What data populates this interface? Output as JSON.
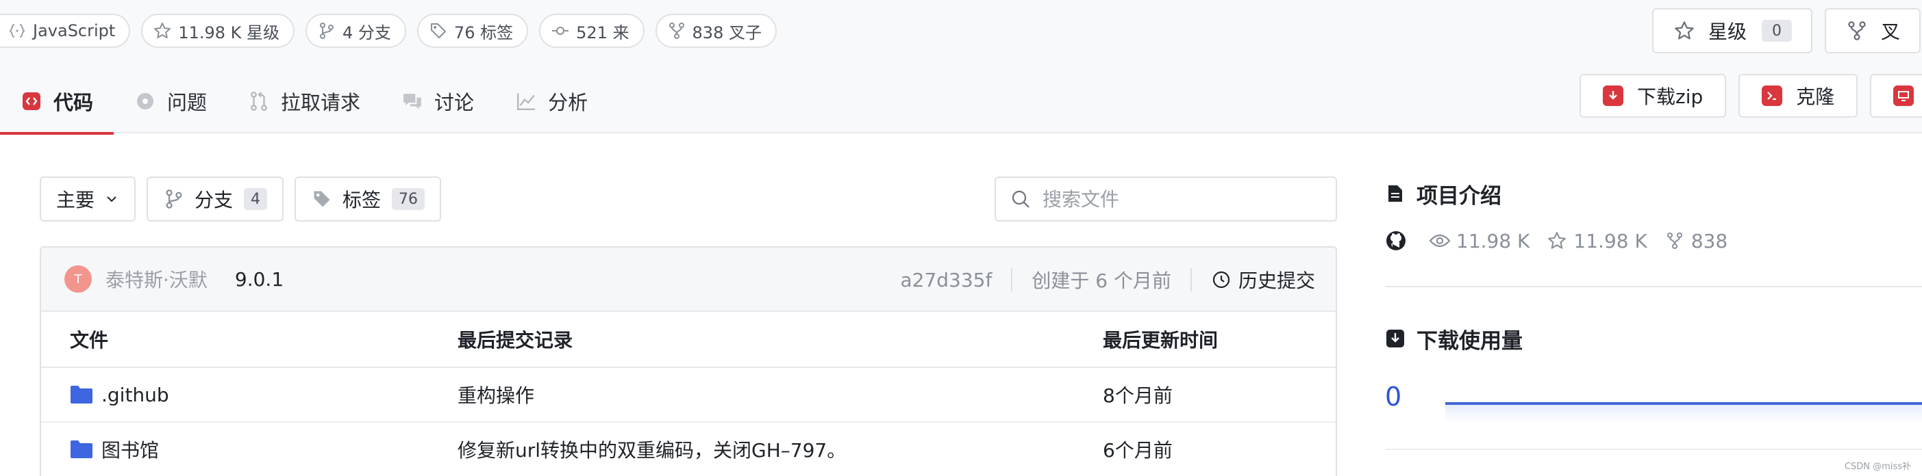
{
  "meta_chips": [
    {
      "icon": "code-braces-icon",
      "label": "JavaScript"
    },
    {
      "icon": "star-icon",
      "label": "11.98 K 星级"
    },
    {
      "icon": "branch-icon",
      "label": "4 分支"
    },
    {
      "icon": "tag-icon",
      "label": "76 标签"
    },
    {
      "icon": "commit-icon",
      "label": "521 来"
    },
    {
      "icon": "fork-icon",
      "label": "838 叉子"
    }
  ],
  "repo_actions": {
    "star_label": "星级",
    "star_count": "0",
    "fork_label": "叉"
  },
  "tabs": [
    {
      "icon": "code-icon",
      "label": "代码",
      "active": true
    },
    {
      "icon": "issue-icon",
      "label": "问题"
    },
    {
      "icon": "pull-request-icon",
      "label": "拉取请求"
    },
    {
      "icon": "discussion-icon",
      "label": "讨论"
    },
    {
      "icon": "analytics-icon",
      "label": "分析"
    }
  ],
  "download_actions": {
    "download_zip": "下载zip",
    "clone": "克隆"
  },
  "toolbar": {
    "branch_select": "主要",
    "branches_label": "分支",
    "branches_count": "4",
    "tags_label": "标签",
    "tags_count": "76",
    "search_placeholder": "搜索文件"
  },
  "commit": {
    "avatar_initial": "T",
    "author": "泰特斯·沃默",
    "message": "9.0.1",
    "sha": "a27d335f",
    "created": "创建于 6 个月前",
    "history": "历史提交"
  },
  "file_table": {
    "headers": [
      "文件",
      "最后提交记录",
      "最后更新时间"
    ],
    "rows": [
      {
        "name": ".github",
        "commit": "重构操作",
        "updated": "8个月前"
      },
      {
        "name": "图书馆",
        "commit": "修复新url转换中的双重编码，关闭GH–797。",
        "updated": "6个月前"
      }
    ]
  },
  "sidebar": {
    "intro_title": "项目介绍",
    "watch_count": "11.98 K",
    "star_count": "11.98 K",
    "fork_count": "838",
    "downloads_title": "下载使用量",
    "downloads_count": "0"
  },
  "watermark": "CSDN @miss补",
  "colors": {
    "accent": "#d9363e",
    "link_blue": "#2f55d4",
    "folder_blue": "#3d66e0"
  }
}
